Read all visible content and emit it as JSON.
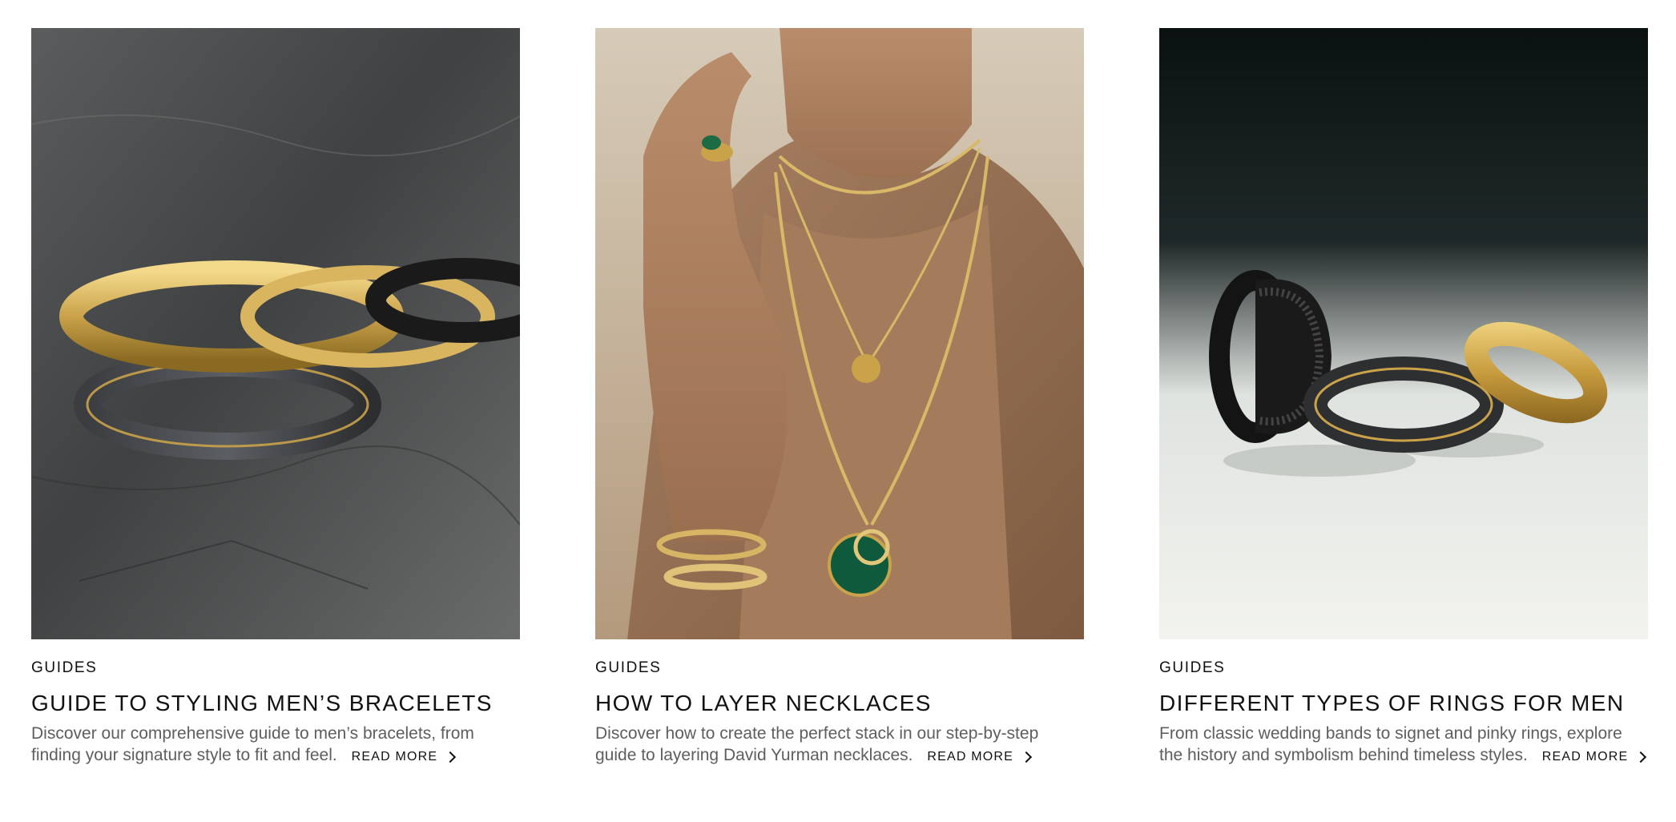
{
  "cards": [
    {
      "image_alt": "Gold and black men's bracelets stacked on slate stone",
      "category": "GUIDES",
      "title": "GUIDE TO STYLING MEN’S BRACELETS",
      "description": "Discover our comprehensive guide to men’s bracelets, from finding your signature style to fit and feel.",
      "read_more": "READ MORE"
    },
    {
      "image_alt": "Woman wearing layered gold chain necklaces with malachite pendant",
      "category": "GUIDES",
      "title": "HOW TO LAYER NECKLACES",
      "description": "Discover how to create the perfect stack in our step-by-step guide to layering David Yurman necklaces.",
      "read_more": "READ MORE"
    },
    {
      "image_alt": "Black, forged carbon and gold men's rings on a gradient background",
      "category": "GUIDES",
      "title": "DIFFERENT TYPES OF RINGS FOR MEN",
      "description": "From classic wedding bands to signet and pinky rings, explore the history and symbolism behind timeless styles.",
      "read_more": "READ MORE"
    }
  ],
  "colors": {
    "text_primary": "#111111",
    "text_secondary": "#5e5e5e",
    "gold": "#c9a24a",
    "background": "#ffffff"
  }
}
